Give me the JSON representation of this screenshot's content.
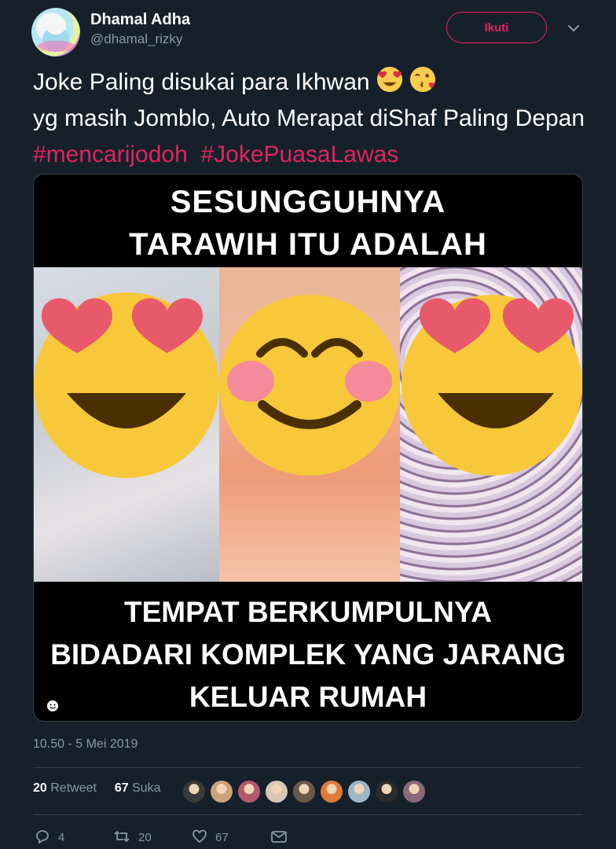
{
  "user": {
    "display_name": "Dhamal Adha",
    "handle": "@dhamal_rizky",
    "follow_label": "Ikuti"
  },
  "tweet": {
    "text_part1": "Joke Paling disukai para Ikhwan ",
    "text_part2": "yg masih Jomblo, Auto Merapat diShaf Paling Depan ",
    "hashtag1": "#mencarijodoh",
    "hashtag2": "#JokePuasaLawas",
    "emojis": [
      "heart-eyes-emoji",
      "kissing-heart-emoji"
    ]
  },
  "media": {
    "top_line1": "SESUNGGUHNYA",
    "top_line2": "TARAWIH ITU ADALAH",
    "bottom_line1": "TEMPAT BERKUMPULNYA",
    "bottom_line2": "BIDADARI KOMPLEK YANG JARANG",
    "bottom_line3": "KELUAR RUMAH",
    "panels": [
      "heart-eyes-emoji",
      "smiling-blush-emoji",
      "heart-eyes-emoji"
    ]
  },
  "timestamp": "10.50 - 5 Mei 2019",
  "stats": {
    "retweet_count": "20",
    "retweet_label": "Retweet",
    "like_count": "67",
    "like_label": "Suka"
  },
  "likers_colors": [
    "#3a3a3a",
    "#c9a27a",
    "#b35a6a",
    "#d8c7b2",
    "#6a5848",
    "#e27a3a",
    "#9db7c9",
    "#2b2b2b",
    "#8a6a7a"
  ],
  "actions": {
    "reply_count": "4",
    "retweet_count": "20",
    "like_count": "67"
  },
  "colors": {
    "background": "#15202b",
    "accent": "#e0245e",
    "muted": "#8899a6"
  }
}
